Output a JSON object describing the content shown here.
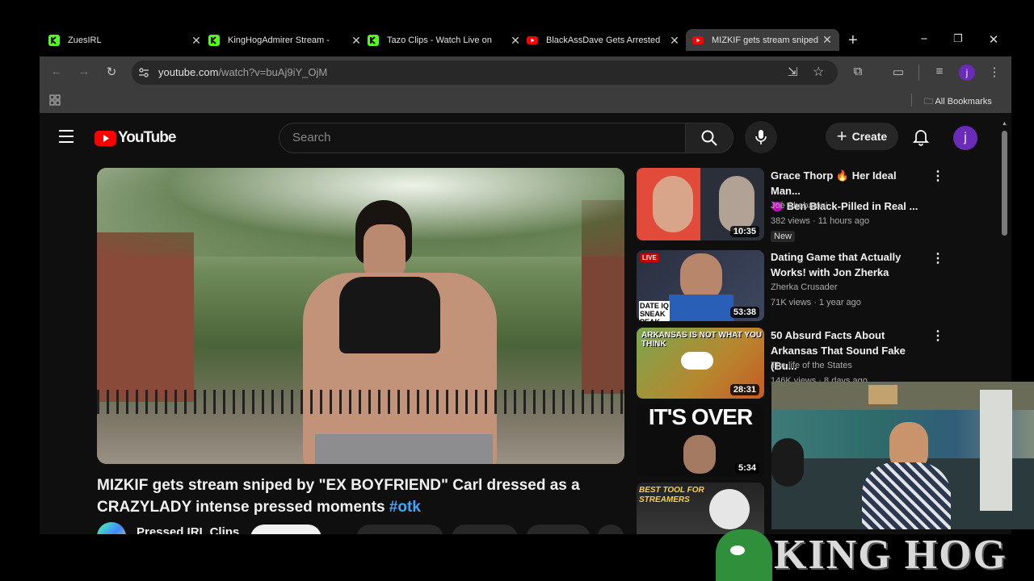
{
  "tabs": [
    {
      "title": "ZuesIRL",
      "favicon": "kick",
      "color": "#53fc18"
    },
    {
      "title": "KingHogAdmirer Stream - ",
      "favicon": "kick",
      "color": "#53fc18"
    },
    {
      "title": "Tazo Clips - Watch Live on",
      "favicon": "kick",
      "color": "#53fc18"
    },
    {
      "title": "BlackAssDave Gets Arrested",
      "favicon": "youtube",
      "color": "#ff0000"
    },
    {
      "title": "MIZKIF gets stream sniped",
      "favicon": "youtube",
      "color": "#ff0000",
      "active": true
    }
  ],
  "address": {
    "host": "youtube.com",
    "path": "/watch?v=buAj9iY_OjM"
  },
  "profile_initial": "j",
  "bookmarks": {
    "all_label": "All Bookmarks"
  },
  "youtube": {
    "logo_text": "YouTube",
    "search_placeholder": "Search",
    "create_label": "Create",
    "avatar_initial": "j",
    "video": {
      "title_main": "MIZKIF gets stream sniped by \"EX BOYFRIEND\" Carl dressed as a CRAZYLADY intense pressed moments ",
      "hashtag": "#otk",
      "channel": "Pressed IRL Clips"
    },
    "recommendations": [
      {
        "line1": "Grace Thorp 🔥 Her Ideal Man...",
        "line2": "😈 Ben Black-Pilled in Real ...",
        "channel": "Joe Shabatoni",
        "meta": "382 views · 11 hours ago",
        "badge": "New",
        "duration": "10:35"
      },
      {
        "line1": "Dating Game that Actually",
        "line2": "Works! with Jon Zherka",
        "channel": "Zherka Crusader",
        "meta": "71K views · 1 year ago",
        "duration": "53:38",
        "thumb_tag": "LIVE",
        "thumb_text": "DATE IQ SNEAK PEAK"
      },
      {
        "line1": "50 Absurd Facts About",
        "line2": "Arkansas That Sound Fake (Bu...",
        "channel": "The life of the States",
        "meta": "146K views · 8 days ago",
        "duration": "28:31",
        "thumb_text": "ARKANSAS IS NOT WHAT YOU THINK"
      },
      {
        "line1": "",
        "line2": "",
        "channel": "",
        "meta": "",
        "duration": "5:34",
        "thumb_text": "IT'S OVER"
      },
      {
        "line1": "",
        "line2": "",
        "channel": "",
        "meta": "",
        "duration": "",
        "thumb_text": "BEST TOOL FOR STREAMERS"
      }
    ]
  },
  "overlay": {
    "banner_text": "KING HOG"
  }
}
